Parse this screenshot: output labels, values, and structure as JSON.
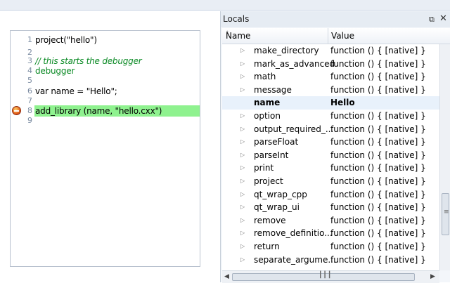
{
  "editor": {
    "lines": [
      {
        "num": "1",
        "text": "project(\"hello\")",
        "style": "plain"
      },
      {
        "num": "2",
        "text": "",
        "style": "plain"
      },
      {
        "num": "3",
        "text": "// this starts the debugger",
        "style": "comment"
      },
      {
        "num": "4",
        "text": "debugger",
        "style": "green"
      },
      {
        "num": "5",
        "text": "",
        "style": "plain"
      },
      {
        "num": "6",
        "text": "var name = \"Hello\";",
        "style": "plain"
      },
      {
        "num": "7",
        "text": "",
        "style": "plain"
      },
      {
        "num": "8",
        "text": "add_library (name, \"hello.cxx\")",
        "style": "plain"
      },
      {
        "num": "9",
        "text": "",
        "style": "plain"
      }
    ],
    "highlight_color": "#8ff28f"
  },
  "locals": {
    "title": "Locals",
    "float_icon": "float-icon",
    "close_icon": "close-icon",
    "col_name": "Name",
    "col_value": "Value",
    "rows": [
      {
        "name": "make_directory",
        "value": "function () { [native] }"
      },
      {
        "name": "mark_as_advanced",
        "value": "function () { [native] }"
      },
      {
        "name": "math",
        "value": "function () { [native] }"
      },
      {
        "name": "message",
        "value": "function () { [native] }"
      },
      {
        "name": "name",
        "value": "Hello"
      },
      {
        "name": "option",
        "value": "function () { [native] }"
      },
      {
        "name": "output_required_...",
        "value": "function () { [native] }"
      },
      {
        "name": "parseFloat",
        "value": "function () { [native] }"
      },
      {
        "name": "parseInt",
        "value": "function () { [native] }"
      },
      {
        "name": "print",
        "value": "function () { [native] }"
      },
      {
        "name": "project",
        "value": "function () { [native] }"
      },
      {
        "name": "qt_wrap_cpp",
        "value": "function () { [native] }"
      },
      {
        "name": "qt_wrap_ui",
        "value": "function () { [native] }"
      },
      {
        "name": "remove",
        "value": "function () { [native] }"
      },
      {
        "name": "remove_definitio...",
        "value": "function () { [native] }"
      },
      {
        "name": "return",
        "value": "function () { [native] }"
      },
      {
        "name": "separate_argume...",
        "value": "function () { [native] }"
      }
    ]
  }
}
